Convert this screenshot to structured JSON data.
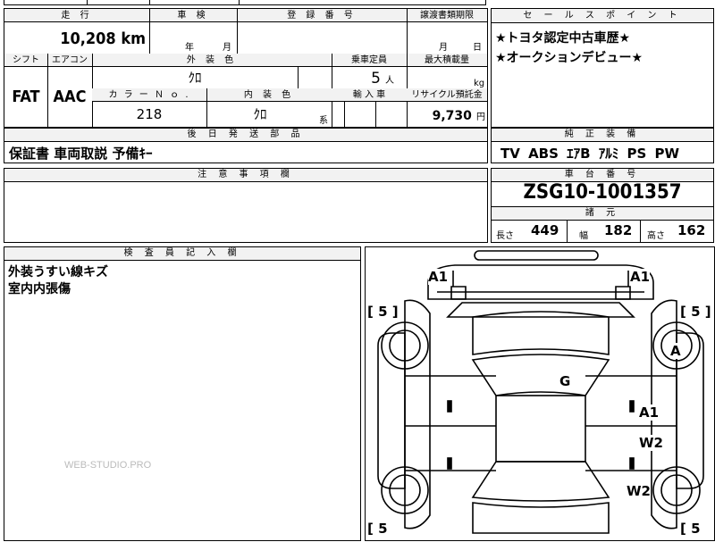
{
  "top_strip": {
    "a": "",
    "b": ""
  },
  "mileage": {
    "header": "走 行",
    "value": "10,208",
    "unit": "km"
  },
  "inspection": {
    "header": "車 検",
    "year_unit": "年",
    "month_unit": "月"
  },
  "registration": {
    "header": "登 録 番 号"
  },
  "transfer": {
    "header": "譲渡書類期限",
    "month_unit": "月",
    "day_unit": "日"
  },
  "shift": {
    "header": "シフト",
    "value": "FAT"
  },
  "aircon": {
    "header": "エアコン",
    "value": "AAC"
  },
  "exterior": {
    "header": "外 装 色",
    "value": "ｸﾛ"
  },
  "capacity": {
    "header": "乗車定員",
    "value": "5",
    "unit": "人"
  },
  "max_load": {
    "header": "最大積載量",
    "unit": "kg"
  },
  "color_no": {
    "header": "カ ラ ー Ｎ ｏ .",
    "value": "218"
  },
  "interior": {
    "header": "内 装 色",
    "value": "ｸﾛ",
    "unit": "系"
  },
  "import": {
    "header": "輸 入 車"
  },
  "recycle": {
    "header": "リサイクル預託金",
    "value": "9,730",
    "unit": "円"
  },
  "sales_point": {
    "header": "セ ー ル ス ポ イ ン ト",
    "lines": [
      "★トヨタ認定中古車歴★",
      "★オークションデビュー★"
    ]
  },
  "later_parts": {
    "header": "後 日 発 送 部 品",
    "value": "保証書 車両取説 予備ｷｰ"
  },
  "genuine_equipment": {
    "header": "純 正 装 備",
    "value": "TV ABS ｴｱB ｱﾙﾐ PS PW"
  },
  "notes": {
    "header": "注 意 事 項 欄"
  },
  "chassis": {
    "header": "車 台 番 号",
    "value": "ZSG10-1001357"
  },
  "specs": {
    "header": "諸 元",
    "length_label": "長さ",
    "length": "449",
    "width_label": "幅",
    "width": "182",
    "height_label": "高さ",
    "height": "162"
  },
  "inspector": {
    "header": "検 査 員 記 入 欄",
    "lines": [
      "外装うすい線キズ",
      "室内内張傷"
    ]
  },
  "diagram": {
    "marks": {
      "front_left": "A1",
      "front_right": "A1",
      "right_front_wheel": "A",
      "windshield": "G",
      "right_front_door": "A1",
      "right_rear_door": "W2",
      "right_rear_wheel": "W2"
    },
    "tire_labels": {
      "front_left": "[ 5 ]",
      "front_right": "[ 5 ]",
      "rear_left": "[ 5",
      "rear_right": "[ 5"
    }
  },
  "watermark": "WEB-STUDIO.PRO"
}
